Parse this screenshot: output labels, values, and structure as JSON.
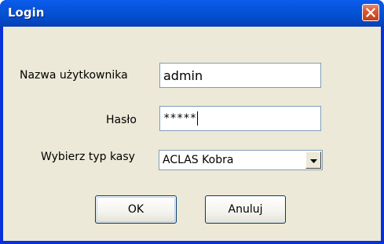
{
  "window": {
    "title": "Login"
  },
  "form": {
    "username_label": "Nazwa użytkownika",
    "username_value": "admin",
    "password_label": "Hasło",
    "password_value": "*****",
    "cash_type_label": "Wybierz typ kasy",
    "cash_type_value": "ACLAS Kobra"
  },
  "buttons": {
    "ok_label": "OK",
    "cancel_label": "Anuluj"
  },
  "icons": {
    "close": "close-icon",
    "dropdown": "chevron-down-icon"
  },
  "colors": {
    "titlebar": "#0553d6",
    "close_button": "#d55a36",
    "dialog_bg": "#ece9d8"
  }
}
